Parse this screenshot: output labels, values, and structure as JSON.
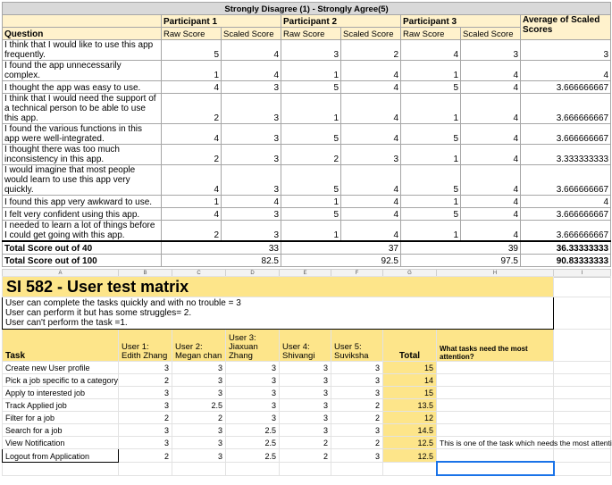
{
  "survey": {
    "title": "Strongly Disagree (1) - Strongly Agree(5)",
    "question_header": "Question",
    "participants": [
      "Participant 1",
      "Participant 2",
      "Participant 3"
    ],
    "average_header": "Average of Scaled Scores",
    "raw_label": "Raw Score",
    "scaled_label": "Scaled Score",
    "rows": [
      {
        "q": "I think that I would like to use this app frequently.",
        "p1r": "5",
        "p1s": "4",
        "p2r": "3",
        "p2s": "2",
        "p3r": "4",
        "p3s": "3",
        "avg": "3"
      },
      {
        "q": "I found the app unnecessarily complex.",
        "p1r": "1",
        "p1s": "4",
        "p2r": "1",
        "p2s": "4",
        "p3r": "1",
        "p3s": "4",
        "avg": "4"
      },
      {
        "q": "I thought the app was easy to use.",
        "p1r": "4",
        "p1s": "3",
        "p2r": "5",
        "p2s": "4",
        "p3r": "5",
        "p3s": "4",
        "avg": "3.666666667"
      },
      {
        "q": "I think that I would need the support of a technical person to be able to use this app.",
        "p1r": "2",
        "p1s": "3",
        "p2r": "1",
        "p2s": "4",
        "p3r": "1",
        "p3s": "4",
        "avg": "3.666666667"
      },
      {
        "q": "I found the various functions in this app were well-integrated.",
        "p1r": "4",
        "p1s": "3",
        "p2r": "5",
        "p2s": "4",
        "p3r": "5",
        "p3s": "4",
        "avg": "3.666666667"
      },
      {
        "q": "I thought there was too much inconsistency in this app.",
        "p1r": "2",
        "p1s": "3",
        "p2r": "2",
        "p2s": "3",
        "p3r": "1",
        "p3s": "4",
        "avg": "3.333333333"
      },
      {
        "q": "I would imagine that most people would learn to use this app very quickly.",
        "p1r": "4",
        "p1s": "3",
        "p2r": "5",
        "p2s": "4",
        "p3r": "5",
        "p3s": "4",
        "avg": "3.666666667"
      },
      {
        "q": "I found this app very awkward to use.",
        "p1r": "1",
        "p1s": "4",
        "p2r": "1",
        "p2s": "4",
        "p3r": "1",
        "p3s": "4",
        "avg": "4"
      },
      {
        "q": "I felt very confident using this app.",
        "p1r": "4",
        "p1s": "3",
        "p2r": "5",
        "p2s": "4",
        "p3r": "5",
        "p3s": "4",
        "avg": "3.666666667"
      },
      {
        "q": "I needed to learn a lot of things before I could get going with this app.",
        "p1r": "2",
        "p1s": "3",
        "p2r": "1",
        "p2s": "4",
        "p3r": "1",
        "p3s": "4",
        "avg": "3.666666667"
      }
    ],
    "totals": [
      {
        "label": "Total Score out of 40",
        "p1": "33",
        "p2": "37",
        "p3": "39",
        "avg": "36.33333333"
      },
      {
        "label": "Total Score out of 100",
        "p1": "82.5",
        "p2": "92.5",
        "p3": "97.5",
        "avg": "90.83333333"
      }
    ]
  },
  "sheet": {
    "col_headers": [
      "A",
      "B",
      "C",
      "D",
      "E",
      "F",
      "G",
      "H",
      "I"
    ],
    "title": "SI 582 - User test matrix",
    "legend": [
      "User can complete the tasks quickly and with no trouble = 3",
      "User can perform it but has some struggles= 2.",
      "User can't perform the task =1."
    ],
    "headers": {
      "task": "Task",
      "u1": "User 1: Edith Zhang",
      "u2": "User 2: Megan chan",
      "u3": "User 3: Jiaxuan Zhang",
      "u4": "User 4: Shivangi",
      "u5": "User 5: Suviksha",
      "total": "Total",
      "attention": "What tasks need the most attention?"
    },
    "rows": [
      {
        "task": "Create new User profile",
        "u1": "3",
        "u2": "3",
        "u3": "3",
        "u4": "3",
        "u5": "3",
        "total": "15",
        "note": ""
      },
      {
        "task": "Pick a job specific to a category",
        "u1": "2",
        "u2": "3",
        "u3": "3",
        "u4": "3",
        "u5": "3",
        "total": "14",
        "note": ""
      },
      {
        "task": "Apply to interested job",
        "u1": "3",
        "u2": "3",
        "u3": "3",
        "u4": "3",
        "u5": "3",
        "total": "15",
        "note": ""
      },
      {
        "task": "Track Applied job",
        "u1": "3",
        "u2": "2.5",
        "u3": "3",
        "u4": "3",
        "u5": "2",
        "total": "13.5",
        "note": ""
      },
      {
        "task": "Filter for a job",
        "u1": "2",
        "u2": "2",
        "u3": "3",
        "u4": "3",
        "u5": "2",
        "total": "12",
        "note": ""
      },
      {
        "task": "Search for a job",
        "u1": "3",
        "u2": "3",
        "u3": "2.5",
        "u4": "3",
        "u5": "3",
        "total": "14.5",
        "note": ""
      },
      {
        "task": "View Notification",
        "u1": "3",
        "u2": "3",
        "u3": "2.5",
        "u4": "2",
        "u5": "2",
        "total": "12.5",
        "note": "This is one of the task which needs the most attention"
      },
      {
        "task": "Logout from Application",
        "u1": "2",
        "u2": "3",
        "u3": "2.5",
        "u4": "2",
        "u5": "3",
        "total": "12.5",
        "note": ""
      }
    ]
  }
}
